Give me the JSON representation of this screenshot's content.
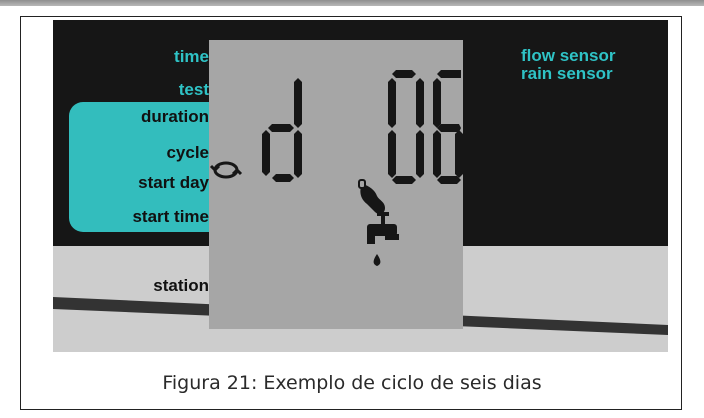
{
  "controller": {
    "left_labels": {
      "time": "time",
      "test": "test",
      "duration": "duration",
      "cycle": "cycle",
      "start_day": "start day",
      "start_time": "start time",
      "station": "station"
    },
    "right_labels": {
      "flow_sensor": "flow sensor",
      "rain_sensor": "rain sensor"
    },
    "display": {
      "left_digit": "d",
      "right_digits": "06",
      "active_mode": "cycle"
    },
    "colors": {
      "accent": "#33bdbd",
      "lcd_background": "#a6a6a6",
      "panel": "#161616",
      "segment": "#161616"
    },
    "icons": [
      "cycle-arrows-icon",
      "hand-pointer-icon",
      "water-faucet-icon",
      "water-drop-icon"
    ]
  },
  "caption": "Figura 21: Exemplo de ciclo de seis dias"
}
